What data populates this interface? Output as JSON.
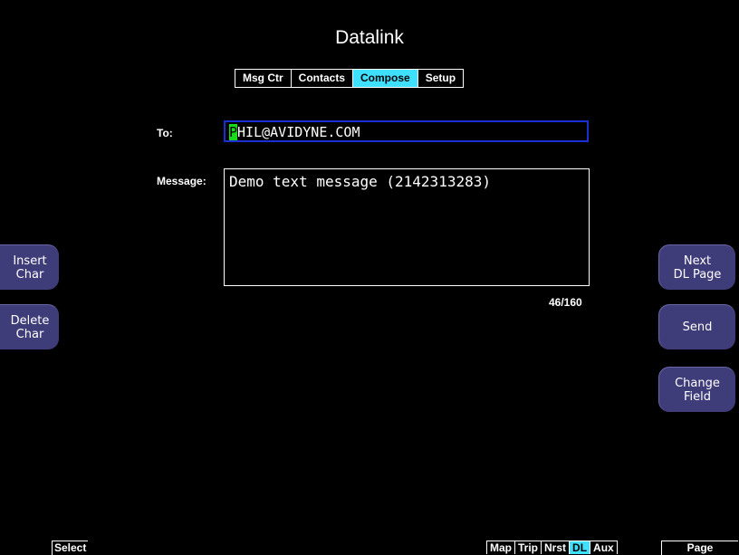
{
  "header": {
    "title": "Datalink"
  },
  "tabs": [
    {
      "label": "Msg Ctr",
      "active": false
    },
    {
      "label": "Contacts",
      "active": false
    },
    {
      "label": "Compose",
      "active": true
    },
    {
      "label": "Setup",
      "active": false
    }
  ],
  "compose": {
    "to_label": "To:",
    "to_cursor_char": "P",
    "to_value_rest": "HIL@AVIDYNE.COM",
    "message_label": "Message:",
    "message_value": "Demo text message (2142313283)",
    "char_count": "46/160"
  },
  "softkeys": {
    "left": [
      {
        "line1": "Insert",
        "line2": "Char"
      },
      {
        "line1": "Delete",
        "line2": "Char"
      }
    ],
    "right": [
      {
        "line1": "Next",
        "line2": "DL Page"
      },
      {
        "line1": "Send",
        "line2": ""
      },
      {
        "line1": "Change",
        "line2": "Field"
      }
    ]
  },
  "bottom": {
    "select_label": "Select",
    "nav": [
      {
        "label": "Map",
        "active": false
      },
      {
        "label": "Trip",
        "active": false
      },
      {
        "label": "Nrst",
        "active": false
      },
      {
        "label": "DL",
        "active": true
      },
      {
        "label": "Aux",
        "active": false
      }
    ],
    "page_label": "Page"
  },
  "colors": {
    "background": "#000000",
    "tab_active": "#3fe0ff",
    "cursor": "#19d91c",
    "focus_border": "#1a2fd1",
    "softkey": "#3f3c7a"
  }
}
